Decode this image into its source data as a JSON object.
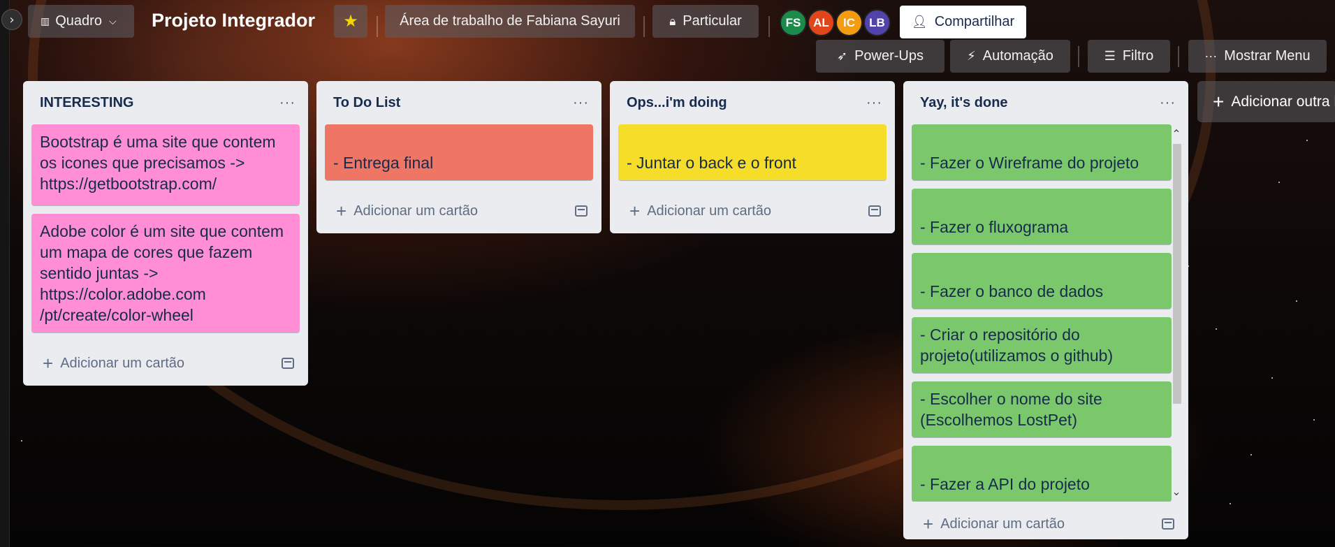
{
  "header": {
    "view_label": "Quadro",
    "board_title": "Projeto Integrador",
    "workspace_label": "Área de trabalho de Fabiana Sayuri",
    "visibility_label": "Particular",
    "share_label": "Compartilhar",
    "avatars": [
      {
        "initials": "FS",
        "color": "#1b8a4a"
      },
      {
        "initials": "AL",
        "color": "#e0451c"
      },
      {
        "initials": "IC",
        "color": "#f39c12"
      },
      {
        "initials": "LB",
        "color": "#5243aa"
      }
    ],
    "powerups_label": "Power-Ups",
    "automation_label": "Automação",
    "filter_label": "Filtro",
    "menu_label": "Mostrar Menu"
  },
  "lists": [
    {
      "title": "INTERESTING",
      "add_label": "Adicionar um cartão",
      "cards": [
        {
          "text": "Bootstrap é uma site que contem os icones que precisamos -> https://getbootstrap.com/",
          "color": "#ff8ed4"
        },
        {
          "text": "Adobe color é um site que contem um mapa de cores que fazem sentido juntas -> https://color.adobe.com /pt/create/color-wheel",
          "color": "#ff8ed4"
        }
      ]
    },
    {
      "title": "To Do List",
      "add_label": "Adicionar um cartão",
      "cards": [
        {
          "text": "- Entrega final",
          "color": "#ef7564"
        }
      ]
    },
    {
      "title": "Ops...i'm doing",
      "add_label": "Adicionar um cartão",
      "cards": [
        {
          "text": "- Juntar o back e o front",
          "color": "#f5dd29"
        }
      ]
    },
    {
      "title": "Yay, it's done",
      "add_label": "Adicionar um cartão",
      "cards": [
        {
          "text": "- Fazer o Wireframe do projeto",
          "color": "#7bc86c"
        },
        {
          "text": "- Fazer o fluxograma",
          "color": "#7bc86c"
        },
        {
          "text": "- Fazer o banco de dados",
          "color": "#7bc86c"
        },
        {
          "text": "- Criar o repositório do projeto(utilizamos o github)",
          "color": "#7bc86c"
        },
        {
          "text": "- Escolher o nome do site (Escolhemos LostPet)",
          "color": "#7bc86c"
        },
        {
          "text": "- Fazer a API do projeto",
          "color": "#7bc86c"
        }
      ]
    }
  ],
  "add_list_label": "Adicionar outra lista"
}
